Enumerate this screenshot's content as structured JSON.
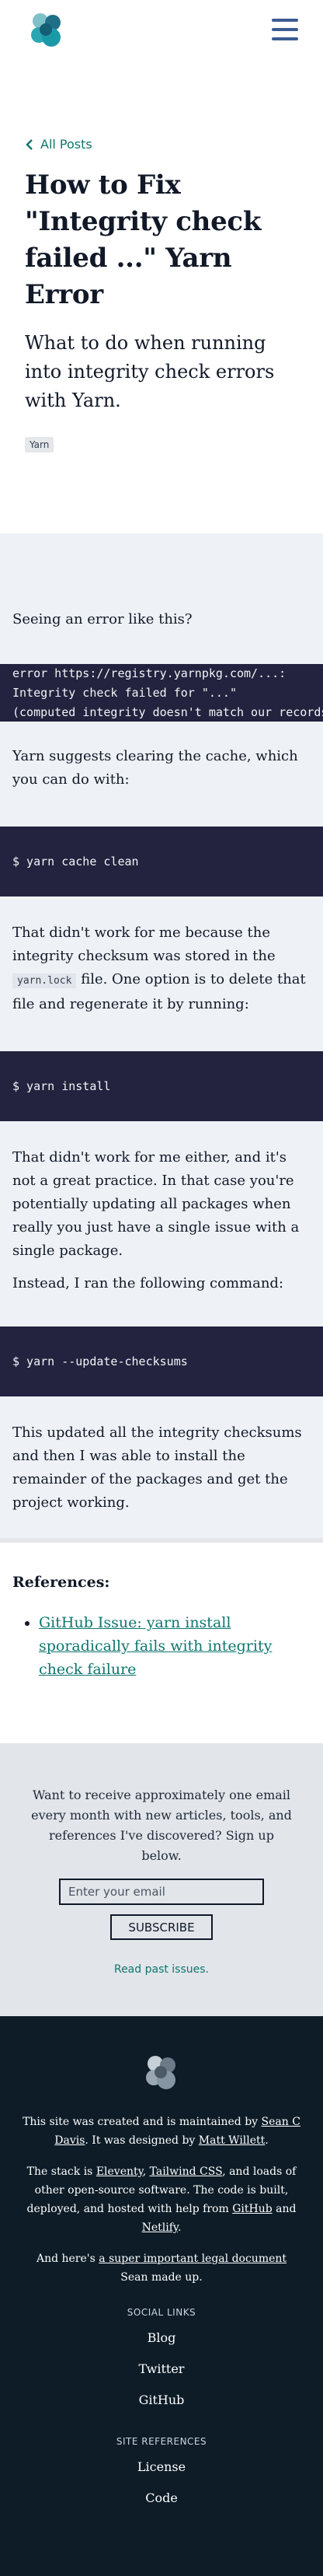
{
  "header": {
    "logo_alt": "site logo",
    "menu_icon": "hamburger-menu-icon"
  },
  "hero": {
    "back_link": "All Posts",
    "title": "How to Fix \"Integrity check failed ...\" Yarn Error",
    "subtitle": "What to do when running into integrity check errors with Yarn.",
    "tag": "Yarn"
  },
  "article": {
    "p1": "Seeing an error like this?",
    "code1": [
      "error https://registry.yarnpkg.com/...:",
      "Integrity check failed for \"...\"",
      "(computed integrity doesn't match our records, got \"...\")"
    ],
    "p2": "Yarn suggests clearing the cache, which you can do with:",
    "code2": "$ yarn cache clean",
    "p3_before": "That didn't work for me because the integrity checksum was stored in the",
    "p3_code": "yarn.lock",
    "p3_after": "file. One option is to delete that file and regenerate it by running:",
    "code3": "$ yarn install",
    "p4": "That didn't work for me either, and it's not a great practice. In that case you're potentially updating all packages when really you just have a single issue with a single package.",
    "p5": "Instead, I ran the following command:",
    "code4": "$ yarn --update-checksums",
    "p6": "This updated all the integrity checksums and then I was able to install the remainder of the packages and get the project working."
  },
  "references": {
    "heading": "References:",
    "items": [
      "GitHub Issue: yarn install sporadically fails with integrity check failure"
    ]
  },
  "newsletter": {
    "text": "Want to receive approximately one email every month with new articles, tools, and references I've discovered? Sign up below.",
    "email_placeholder": "Enter your email",
    "subscribe_label": "SUBSCRIBE",
    "past_issues": "Read past issues."
  },
  "footer": {
    "created_prefix": "This site was created and is maintained by ",
    "created_author": "Sean C Davis",
    "designed_prefix": ". It was designed by ",
    "designer": "Matt Willett",
    "designed_suffix": ".",
    "stack_prefix": "The stack is ",
    "stack_eleventy": "Eleventy",
    "stack_sep1": ", ",
    "stack_tailwind": "Tailwind CSS",
    "stack_middle": ", and loads of other open-source software. The code is built, deployed, and hosted with help from ",
    "stack_github": "GitHub",
    "stack_and": " and ",
    "stack_netlify": "Netlify",
    "stack_suffix": ".",
    "legal_prefix": "And here's ",
    "legal_link": "a super important legal document",
    "legal_suffix": " Sean made up.",
    "social_heading": "SOCIAL LINKS",
    "social_links": [
      "Blog",
      "Twitter",
      "GitHub"
    ],
    "site_heading": "SITE REFERENCES",
    "site_links": [
      "License",
      "Code"
    ]
  },
  "colors": {
    "accent": "#0f766e",
    "menu": "#3b5b91",
    "code_bg": "#23223f",
    "article_bg": "#eef2f7",
    "footer_bg": "#0d1c27"
  }
}
